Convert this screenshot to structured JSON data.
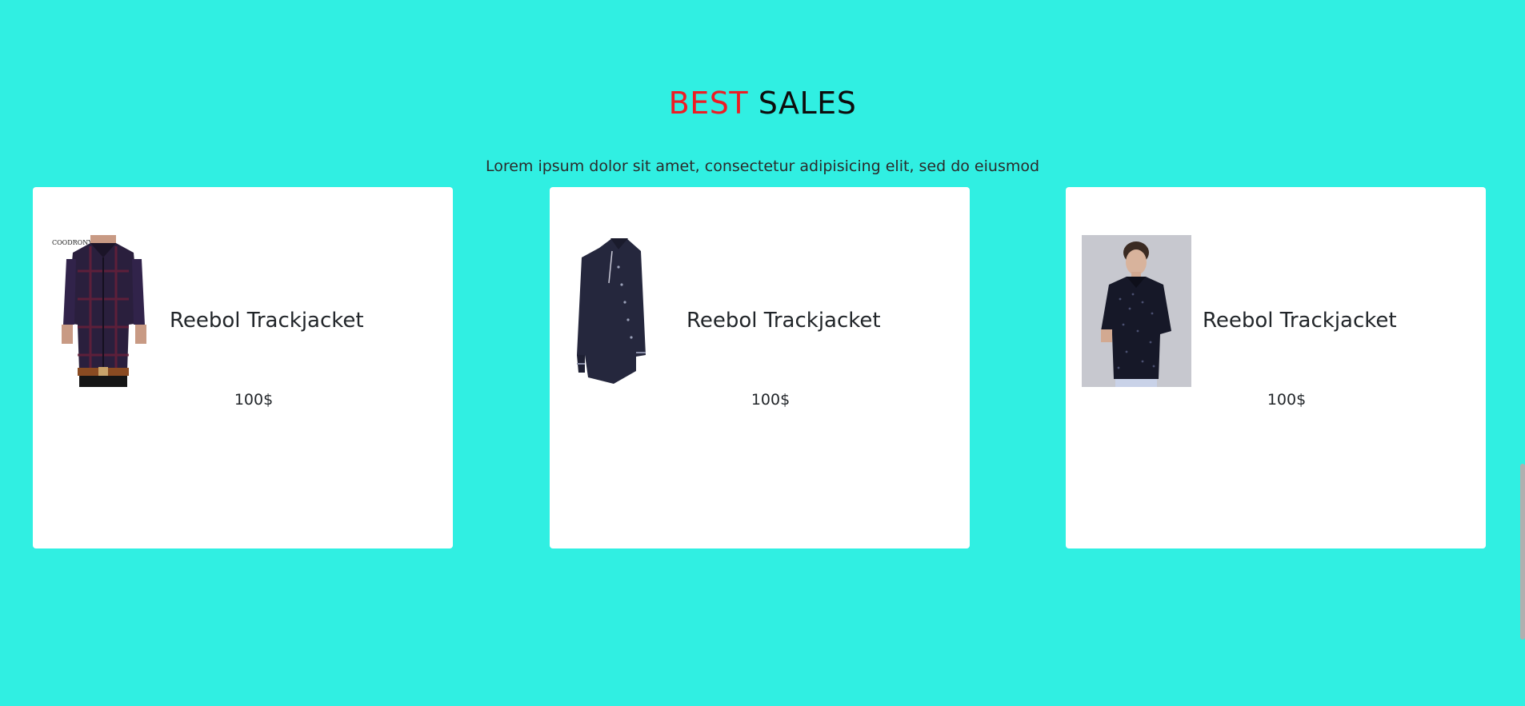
{
  "section": {
    "title_accent": "BEST",
    "title_rest": "SALES",
    "subtitle": "Lorem ipsum dolor sit amet, consectetur adipisicing elit, sed do eiusmod",
    "accent_color": "#ed1c24",
    "background_color": "#30efe2"
  },
  "products": [
    {
      "name": "Reebol Trackjacket",
      "price": "100$",
      "image_icon": "plaid-shirt-image",
      "brand_label": "COODRONY"
    },
    {
      "name": "Reebol Trackjacket",
      "price": "100$",
      "image_icon": "black-shirt-image"
    },
    {
      "name": "Reebol Trackjacket",
      "price": "100$",
      "image_icon": "model-dotted-shirt-image"
    }
  ]
}
